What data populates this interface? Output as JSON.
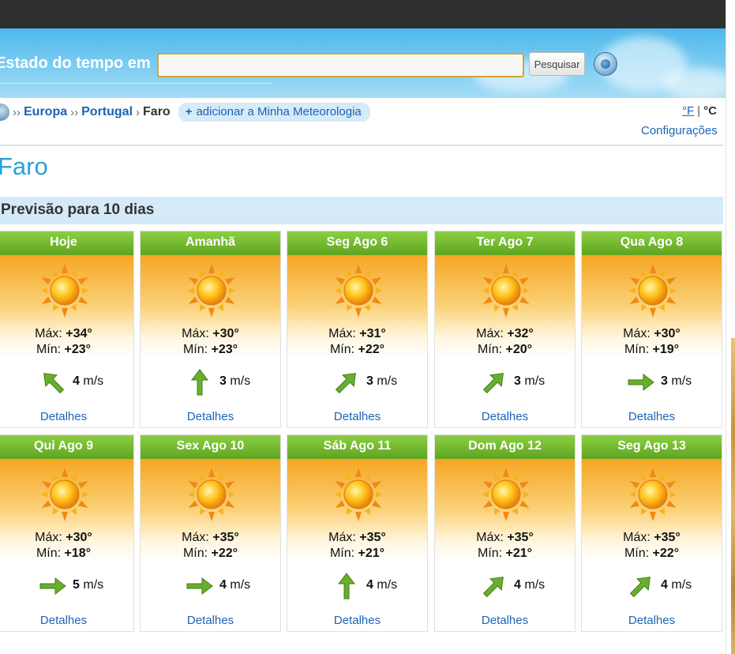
{
  "header": {
    "search_label": "Estado do tempo em",
    "search_value": "",
    "search_button": "Pesquisar",
    "globe_icon": "globe-icon"
  },
  "breadcrumb": {
    "europe": "Europa",
    "country": "Portugal",
    "city": "Faro",
    "add_label": "adicionar a Minha Meteorologia",
    "add_plus": "+"
  },
  "units": {
    "fahrenheit": "°F",
    "separator": "|",
    "celsius": "°C"
  },
  "settings": "Configurações",
  "city_title": "Faro",
  "forecast_heading": "Previsão para 10 dias",
  "labels": {
    "max": "Máx:",
    "min": "Mín:",
    "wind_unit": "m/s",
    "details": "Detalhes"
  },
  "days": [
    {
      "name": "Hoje",
      "max": "+34°",
      "min": "+23°",
      "wind": "4",
      "dir": "NW",
      "icon": "sun-icon"
    },
    {
      "name": "Amanhã",
      "max": "+30°",
      "min": "+23°",
      "wind": "3",
      "dir": "N",
      "icon": "sun-icon"
    },
    {
      "name": "Seg Ago 6",
      "max": "+31°",
      "min": "+22°",
      "wind": "3",
      "dir": "NE",
      "icon": "sun-icon"
    },
    {
      "name": "Ter Ago 7",
      "max": "+32°",
      "min": "+20°",
      "wind": "3",
      "dir": "NE",
      "icon": "sun-icon"
    },
    {
      "name": "Qua Ago 8",
      "max": "+30°",
      "min": "+19°",
      "wind": "3",
      "dir": "E",
      "icon": "sun-icon"
    },
    {
      "name": "Qui Ago 9",
      "max": "+30°",
      "min": "+18°",
      "wind": "5",
      "dir": "E",
      "icon": "sun-icon"
    },
    {
      "name": "Sex Ago 10",
      "max": "+35°",
      "min": "+22°",
      "wind": "4",
      "dir": "E",
      "icon": "sun-icon"
    },
    {
      "name": "Sáb Ago 11",
      "max": "+35°",
      "min": "+21°",
      "wind": "4",
      "dir": "N",
      "icon": "sun-icon"
    },
    {
      "name": "Dom Ago 12",
      "max": "+35°",
      "min": "+21°",
      "wind": "4",
      "dir": "NE",
      "icon": "sun-icon"
    },
    {
      "name": "Seg Ago 13",
      "max": "+35°",
      "min": "+22°",
      "wind": "4",
      "dir": "NE",
      "icon": "sun-icon"
    }
  ]
}
